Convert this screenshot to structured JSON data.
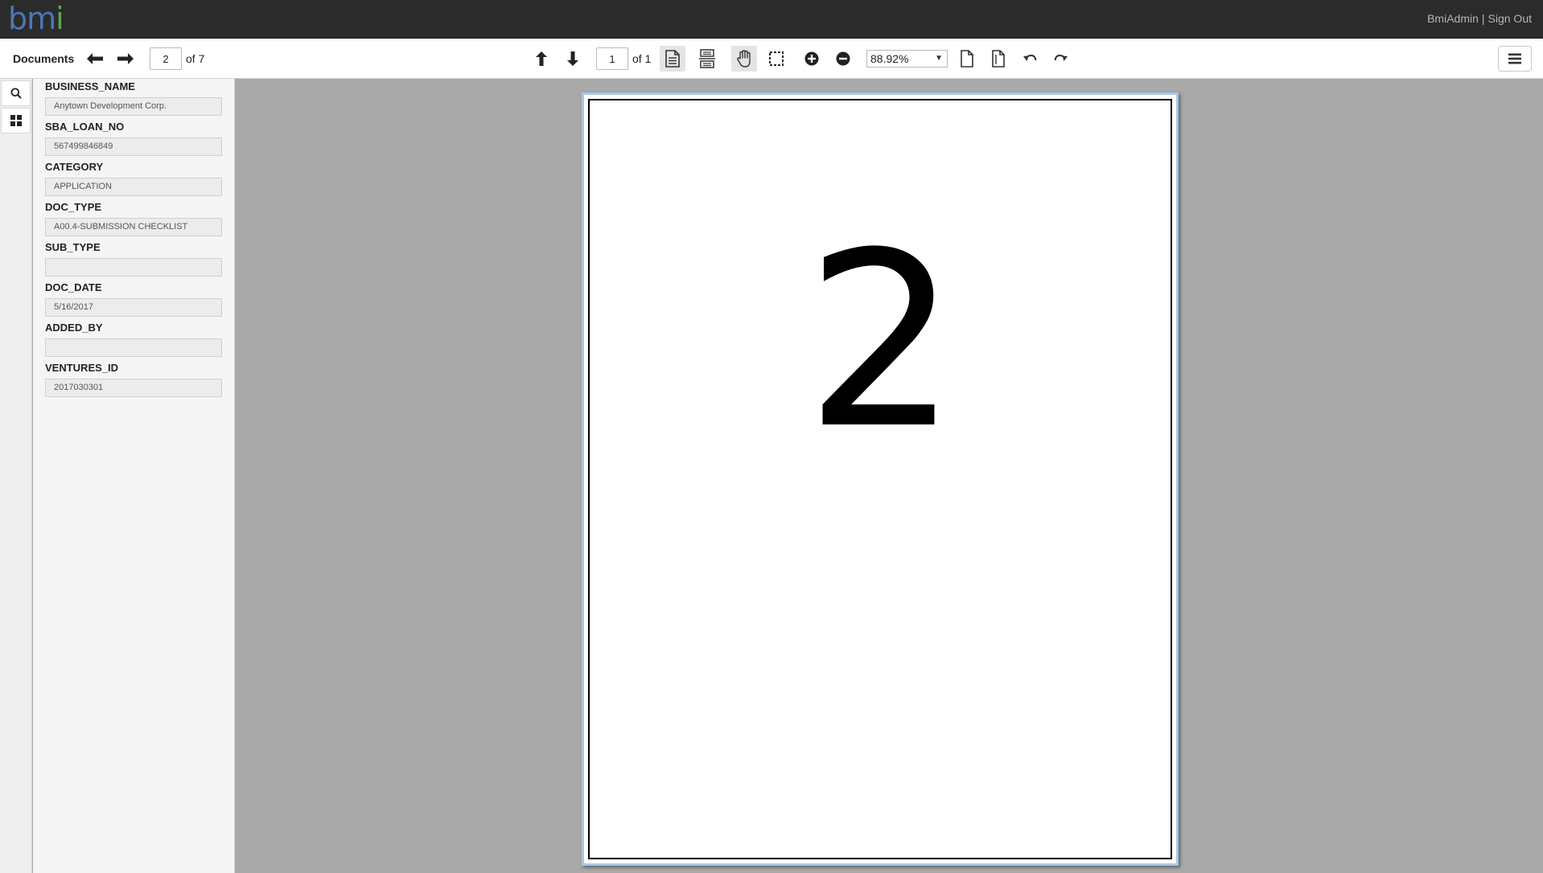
{
  "header": {
    "logo_main": "bm",
    "logo_i": "i",
    "user": "BmiAdmin",
    "separator": "|",
    "sign_out": "Sign Out"
  },
  "toolbar": {
    "documents_label": "Documents",
    "doc_page_value": "2",
    "doc_page_of": "of 7",
    "page_value": "1",
    "page_of": "of 1",
    "zoom_value": "88.92%",
    "zoom_arrow": "▼"
  },
  "fields": [
    {
      "label": "BUSINESS_NAME",
      "value": "Anytown Development Corp."
    },
    {
      "label": "SBA_LOAN_NO",
      "value": "567499846849"
    },
    {
      "label": "CATEGORY",
      "value": "APPLICATION"
    },
    {
      "label": "DOC_TYPE",
      "value": "A00.4-SUBMISSION CHECKLIST"
    },
    {
      "label": "SUB_TYPE",
      "value": ""
    },
    {
      "label": "DOC_DATE",
      "value": "5/16/2017"
    },
    {
      "label": "ADDED_BY",
      "value": ""
    },
    {
      "label": "VENTURES_ID",
      "value": "2017030301"
    }
  ],
  "document": {
    "page_content": "2"
  }
}
